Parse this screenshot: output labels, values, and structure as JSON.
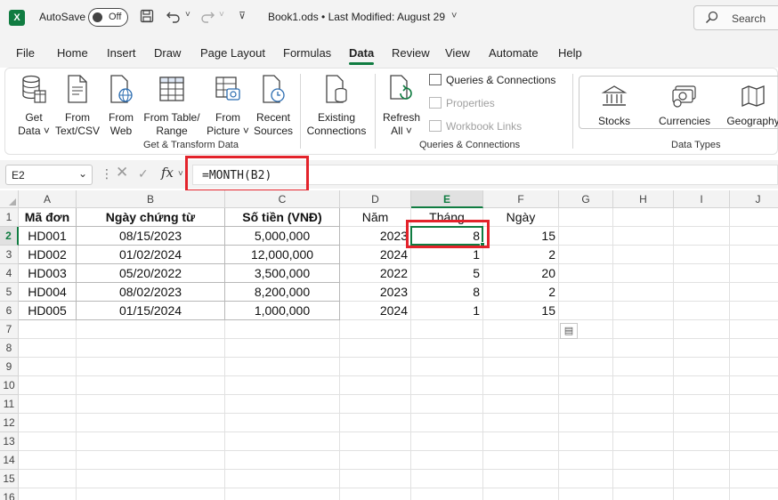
{
  "titlebar": {
    "autosave_label": "AutoSave",
    "autosave_state": "Off",
    "book_title": "Book1.ods • Last Modified: August 29",
    "search_placeholder": "Search"
  },
  "menu": {
    "tabs": [
      "File",
      "Home",
      "Insert",
      "Draw",
      "Page Layout",
      "Formulas",
      "Data",
      "Review",
      "View",
      "Automate",
      "Help"
    ],
    "active": "Data"
  },
  "ribbon": {
    "get_transform": {
      "label": "Get & Transform Data",
      "buttons": [
        {
          "line1": "Get",
          "line2": "Data ˅",
          "icon": "database-icon"
        },
        {
          "line1": "From",
          "line2": "Text/CSV",
          "icon": "text-file-icon"
        },
        {
          "line1": "From",
          "line2": "Web",
          "icon": "web-icon"
        },
        {
          "line1": "From Table/",
          "line2": "Range",
          "icon": "table-icon"
        },
        {
          "line1": "From",
          "line2": "Picture ˅",
          "icon": "picture-icon"
        },
        {
          "line1": "Recent",
          "line2": "Sources",
          "icon": "clock-icon"
        },
        {
          "line1": "Existing",
          "line2": "Connections",
          "icon": "existing-connections-icon"
        }
      ]
    },
    "queries": {
      "label": "Queries & Connections",
      "refresh_line1": "Refresh",
      "refresh_line2": "All ˅",
      "items": [
        "Queries & Connections",
        "Properties",
        "Workbook Links"
      ]
    },
    "data_types": {
      "label": "Data Types",
      "buttons": [
        "Stocks",
        "Currencies",
        "Geography"
      ]
    }
  },
  "formula_bar": {
    "name_box": "E2",
    "formula": "=MONTH(B2)",
    "fx": "fx"
  },
  "sheet": {
    "columns": [
      "A",
      "B",
      "C",
      "D",
      "E",
      "F",
      "G",
      "H",
      "I",
      "J"
    ],
    "selected_column": "E",
    "rows": [
      "1",
      "2",
      "3",
      "4",
      "5",
      "6",
      "7",
      "8",
      "9",
      "10",
      "11",
      "12",
      "13",
      "14",
      "15",
      "16"
    ],
    "selected_row": "2",
    "headers": [
      "Mã đơn",
      "Ngày chứng từ",
      "Số tiền (VNĐ)",
      "Năm",
      "Tháng",
      "Ngày"
    ],
    "data": [
      [
        "HD001",
        "08/15/2023",
        "5,000,000",
        "2023",
        "8",
        "15"
      ],
      [
        "HD002",
        "01/02/2024",
        "12,000,000",
        "2024",
        "1",
        "2"
      ],
      [
        "HD003",
        "05/20/2022",
        "3,500,000",
        "2022",
        "5",
        "20"
      ],
      [
        "HD004",
        "08/02/2023",
        "8,200,000",
        "2023",
        "8",
        "2"
      ],
      [
        "HD005",
        "01/15/2024",
        "1,000,000",
        "2024",
        "1",
        "15"
      ]
    ]
  },
  "colors": {
    "accent": "#107c41",
    "highlight": "#e3232b"
  }
}
